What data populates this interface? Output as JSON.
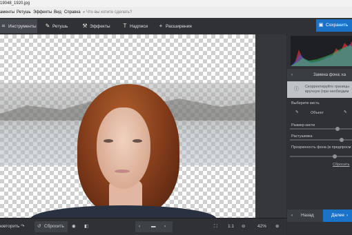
{
  "window": {
    "title": "19048_1920.jpg"
  },
  "menu": {
    "items": [
      "аменты",
      "Ретушь",
      "Эффекты",
      "Вид",
      "Справка"
    ],
    "search_placeholder": "Что вы хотите сделать?"
  },
  "toolbar": {
    "tabs": [
      {
        "label": "Инструменты",
        "icon": "crop-icon"
      },
      {
        "label": "Ретушь",
        "icon": "brush-icon"
      },
      {
        "label": "Эффекты",
        "icon": "magic-wand-icon"
      },
      {
        "label": "Надписи",
        "icon": "text-icon"
      },
      {
        "label": "Расширения",
        "icon": "plus-icon"
      }
    ],
    "save_label": "Сохранить"
  },
  "bottom": {
    "undo_label": "ювторить",
    "reset_label": "Сбросить",
    "ratio_label": "1:1",
    "zoom_label": "42%"
  },
  "panel": {
    "header": "Замена фона: ка",
    "hint": "Скорректируйте границы вручную (при необходим",
    "brush_title": "Выберите кисть",
    "brush_object": "Объект",
    "size_label": "Размер кисти",
    "feather_label": "Растушевка",
    "opacity_label": "Прозрачность фона (в предпросм",
    "reset_link": "Сбросить",
    "back_label": "Назад",
    "next_label": "Далее"
  },
  "colors": {
    "accent": "#1b73c9",
    "panel": "#2f3135"
  }
}
